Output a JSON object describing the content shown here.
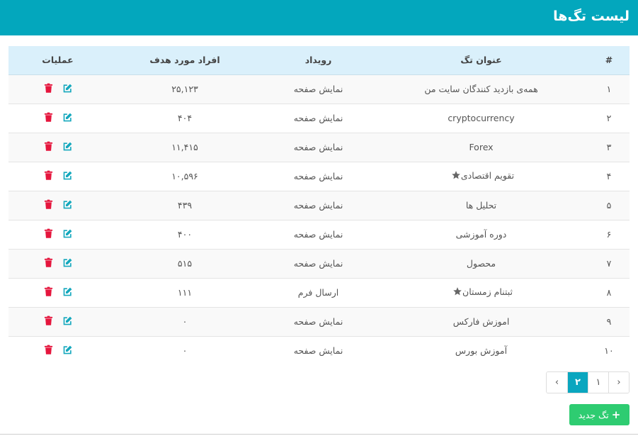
{
  "header": {
    "title": "لیست تگ‌ها"
  },
  "table": {
    "columns": {
      "index": "#",
      "title": "عنوان تگ",
      "event": "رویداد",
      "audience": "افراد مورد هدف",
      "operations": "عملیات"
    },
    "rows": [
      {
        "index": "۱",
        "title": "همه‌ی بازدید کنندگان سایت من",
        "event": "نمایش صفحه",
        "audience": "۲۵,۱۲۳",
        "starred": false
      },
      {
        "index": "۲",
        "title": "cryptocurrency",
        "event": "نمایش صفحه",
        "audience": "۴۰۴",
        "starred": false
      },
      {
        "index": "۳",
        "title": "Forex",
        "event": "نمایش صفحه",
        "audience": "۱۱,۴۱۵",
        "starred": false
      },
      {
        "index": "۴",
        "title": "تقویم اقتصادی",
        "event": "نمایش صفحه",
        "audience": "۱۰,۵۹۶",
        "starred": true
      },
      {
        "index": "۵",
        "title": "تحلیل ها",
        "event": "نمایش صفحه",
        "audience": "۴۳۹",
        "starred": false
      },
      {
        "index": "۶",
        "title": "دوره آموزشی",
        "event": "نمایش صفحه",
        "audience": "۴۰۰",
        "starred": false
      },
      {
        "index": "۷",
        "title": "محصول",
        "event": "نمایش صفحه",
        "audience": "۵۱۵",
        "starred": false
      },
      {
        "index": "۸",
        "title": "ثبتنام زمستان",
        "event": "ارسال فرم",
        "audience": "۱۱۱",
        "starred": true
      },
      {
        "index": "۹",
        "title": "اموزش فارکس",
        "event": "نمایش صفحه",
        "audience": "۰",
        "starred": false
      },
      {
        "index": "۱۰",
        "title": "آموزش بورس",
        "event": "نمایش صفحه",
        "audience": "۰",
        "starred": false
      }
    ]
  },
  "pagination": {
    "prev": "‹",
    "pages": [
      "۱",
      "۲"
    ],
    "active_page": "۲",
    "next": "›"
  },
  "new_tag_button": {
    "label": "تگ جدید",
    "icon": "plus-icon"
  },
  "colors": {
    "header_bg": "#03a7bd",
    "table_head_bg": "#daf0fb",
    "edit_icon": "#15a8bd",
    "delete_icon": "#e5163d",
    "star_icon": "#666666",
    "active_page": "#0aa6bf",
    "new_button": "#2ecc71"
  }
}
